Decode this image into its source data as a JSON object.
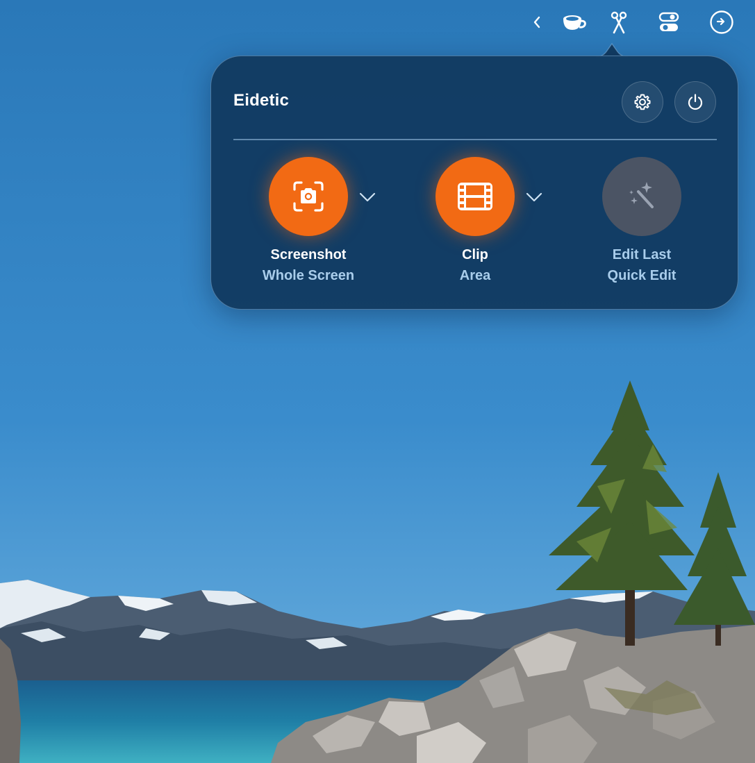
{
  "menubar": {
    "icons": [
      "chevron-left-icon",
      "coffee-cup-icon",
      "scissors-icon",
      "toggles-icon",
      "clock-arrow-icon"
    ]
  },
  "popover": {
    "title": "Eidetic",
    "settings_icon": "gear-icon",
    "power_icon": "power-icon",
    "actions": [
      {
        "title": "Screenshot",
        "subtitle": "Whole Screen",
        "icon": "camera-viewfinder-icon",
        "has_dropdown": true,
        "enabled": true
      },
      {
        "title": "Clip",
        "subtitle": "Area",
        "icon": "film-strip-icon",
        "has_dropdown": true,
        "enabled": true
      },
      {
        "title": "Edit Last",
        "subtitle": "Quick Edit",
        "icon": "magic-wand-icon",
        "has_dropdown": false,
        "enabled": false
      }
    ]
  },
  "colors": {
    "accent": "#f26a14",
    "popover_bg": "#10385e",
    "subtitle": "#a9cdeb"
  }
}
